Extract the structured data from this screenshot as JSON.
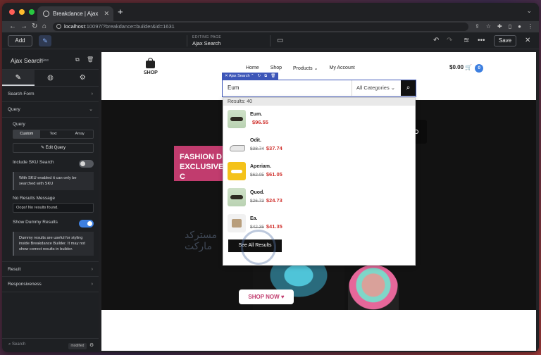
{
  "browser": {
    "tab_title": "Breakdance | Ajax Search",
    "url_host": "localhost",
    "url_path": ":10097/?breakdance=builder&id=1631"
  },
  "topbar": {
    "add_label": "Add",
    "editing_label": "EDITING PAGE",
    "page_name": "Ajax Search",
    "save_label": "Save"
  },
  "panel": {
    "title": "Ajax Search",
    "badge": "New",
    "sections": {
      "search_form": "Search Form",
      "query": "Query",
      "result": "Result",
      "responsiveness": "Responsiveness"
    },
    "query_label": "Query",
    "segments": [
      "Custom",
      "Text",
      "Array"
    ],
    "edit_query": "Edit Query",
    "sku_label": "Include SKU Search",
    "sku_note": "With SKU enabled it can only be searched with SKU",
    "no_results_label": "No Results Message",
    "no_results_value": "Oops! No results found.",
    "dummy_label": "Show Dummy Results",
    "dummy_note": "Dummy results are useful for styling inside Breakdance Builder. It may not show correct results in builder.",
    "search_placeholder": "Search",
    "modified": "modified"
  },
  "site": {
    "logo_text": "SHOP",
    "menu": [
      "Home",
      "Shop",
      "Products",
      "My Account"
    ],
    "cart_total": "$0.00",
    "cart_count": "0",
    "hero_text": "FASHION D EXCLUSIVE C",
    "shop_now": "SHOP NOW ♥"
  },
  "search_widget": {
    "element_label": "Ajax Search",
    "query": "Eum",
    "category": "All Categories",
    "results_header": "Results: 40",
    "see_all": "See All Results",
    "results": [
      {
        "name": "Eum.",
        "old_price": "",
        "price": "$96.55"
      },
      {
        "name": "Odit.",
        "old_price": "$38.74",
        "price": "$37.74"
      },
      {
        "name": "Aperiam.",
        "old_price": "$62.05",
        "price": "$61.05"
      },
      {
        "name": "Quod.",
        "old_price": "$26.73",
        "price": "$24.73"
      },
      {
        "name": "Ea.",
        "old_price": "$42.35",
        "price": "$41.35"
      }
    ]
  },
  "watermark": {
    "line1": "مستركد",
    "line2": "مارکت"
  },
  "colors": {
    "accent": "#3d56b8",
    "toggle_on": "#3d7fe0",
    "hero_pink": "#c13c6e",
    "price_red": "#d0312d"
  }
}
